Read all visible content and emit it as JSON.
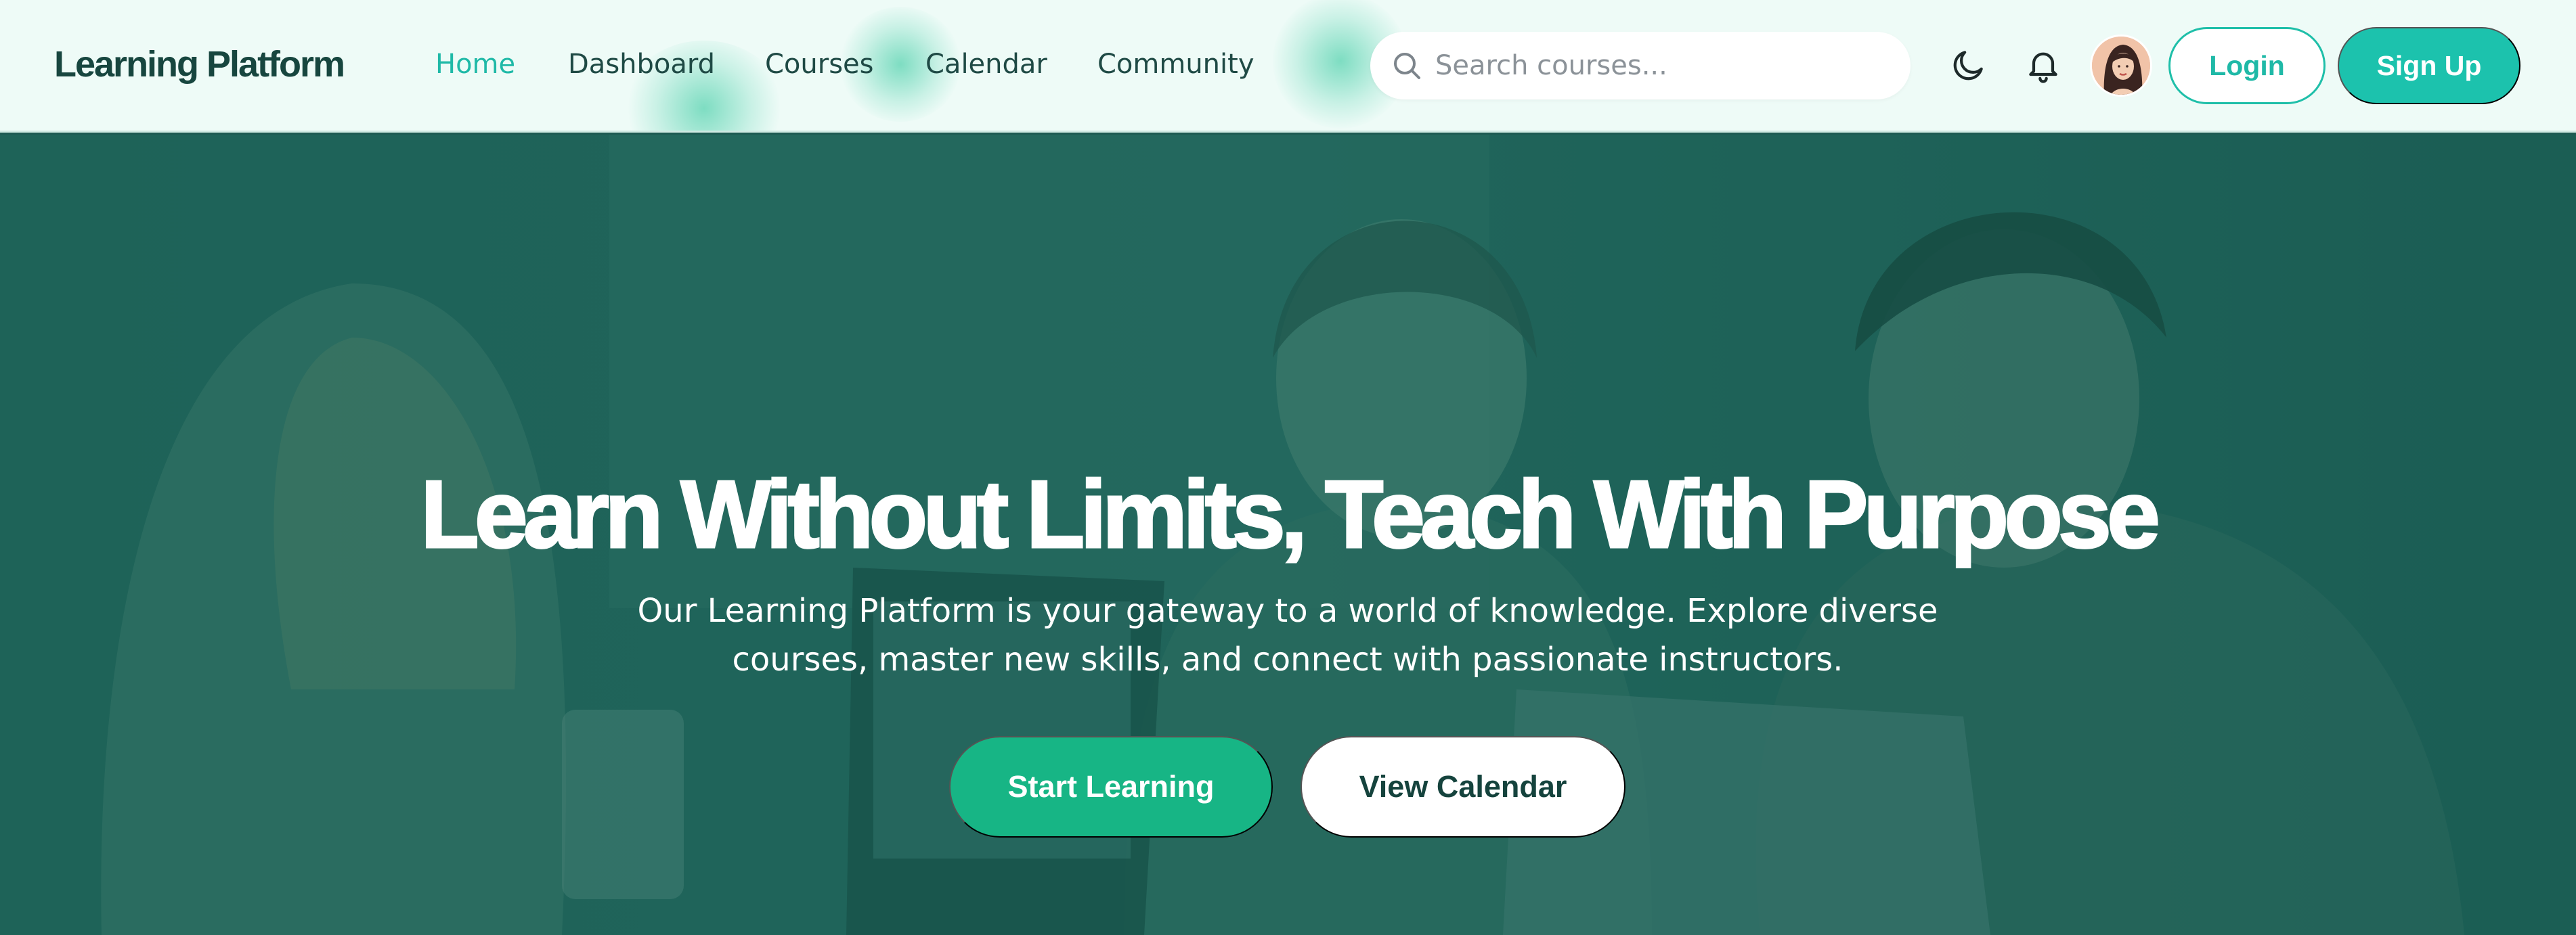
{
  "header": {
    "brand": "Learning Platform",
    "nav": [
      {
        "label": "Home",
        "active": true
      },
      {
        "label": "Dashboard",
        "active": false
      },
      {
        "label": "Courses",
        "active": false
      },
      {
        "label": "Calendar",
        "active": false
      },
      {
        "label": "Community",
        "active": false
      }
    ],
    "search": {
      "placeholder": "Search courses...",
      "value": ""
    },
    "icons": {
      "search": "search-icon",
      "theme": "moon-icon",
      "notifications": "bell-icon",
      "avatar": "user-avatar"
    },
    "login_label": "Login",
    "signup_label": "Sign Up"
  },
  "hero": {
    "title": "Learn Without Limits, Teach With Purpose",
    "subtitle": "Our Learning Platform is your gateway to a world of knowledge. Explore diverse courses, master new skills, and connect with passionate instructors.",
    "primary_cta": "Start Learning",
    "secondary_cta": "View Calendar"
  },
  "colors": {
    "accent": "#1cc2ad",
    "nav_active": "#1fb9a7",
    "hero_overlay": "#1d5a52",
    "start_button": "#17b585",
    "brand_text": "#17463f"
  }
}
